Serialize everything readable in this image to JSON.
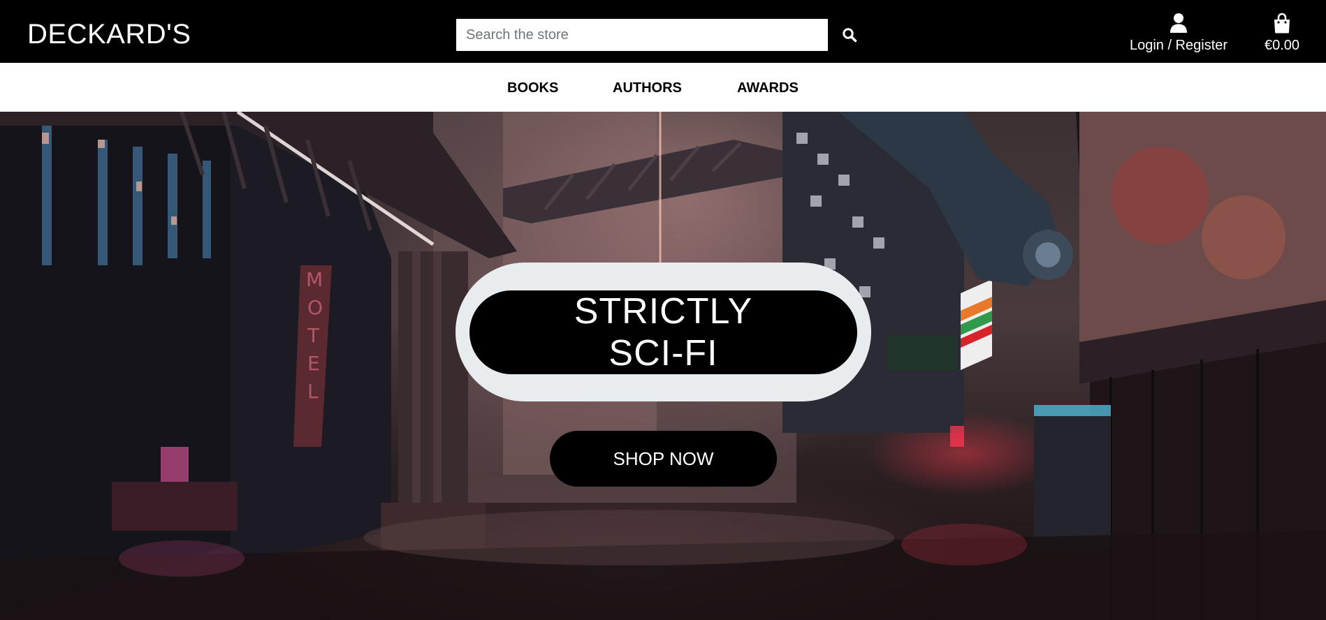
{
  "header": {
    "brand": "DECKARD'S",
    "search": {
      "placeholder": "Search the store",
      "value": "",
      "button_icon": "search-icon"
    },
    "account": {
      "icon": "user-icon",
      "label": "Login / Register"
    },
    "bag": {
      "icon": "shopping-bag-icon",
      "total": "€0.00"
    }
  },
  "nav": {
    "items": [
      {
        "label": "BOOKS"
      },
      {
        "label": "AUTHORS"
      },
      {
        "label": "AWARDS"
      }
    ]
  },
  "hero": {
    "headline_line1": "STRICTLY",
    "headline_line2": "SCI-FI",
    "cta_label": "SHOP NOW",
    "background": "sci-fi city street scene"
  },
  "colors": {
    "header_bg": "#000000",
    "nav_bg": "#ffffff",
    "pill_outer": "#e9ecef",
    "pill_inner": "#000000",
    "text_light": "#ffffff"
  }
}
